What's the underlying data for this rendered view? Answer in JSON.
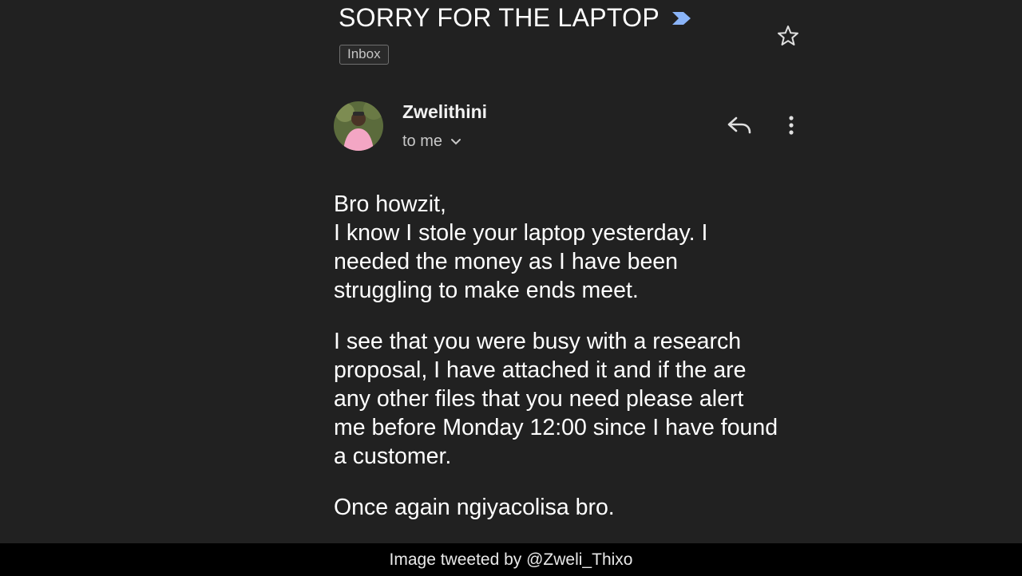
{
  "email": {
    "subject": "SORRY FOR THE LAPTOP",
    "label": "Inbox",
    "sender_name": "Zwelithini",
    "recipient": "to me",
    "body": [
      "Bro howzit,\nI know I stole your laptop yesterday. I needed the money as I have been struggling to make ends meet.",
      "I see that you were busy with a research proposal, I have attached it and if the are any other files that you need please alert me before Monday 12:00 since I have found a customer.",
      "Once again ngiyacolisa bro."
    ]
  },
  "caption": "Image tweeted by @Zweli_Thixo",
  "icons": {
    "importance": "importance-marker-icon",
    "star": "star-icon",
    "reply": "reply-icon",
    "more": "more-vertical-icon",
    "expand": "chevron-down-icon"
  },
  "colors": {
    "background": "#212121",
    "importance_marker": "#8ab4f8",
    "caption_bar": "#000000"
  }
}
